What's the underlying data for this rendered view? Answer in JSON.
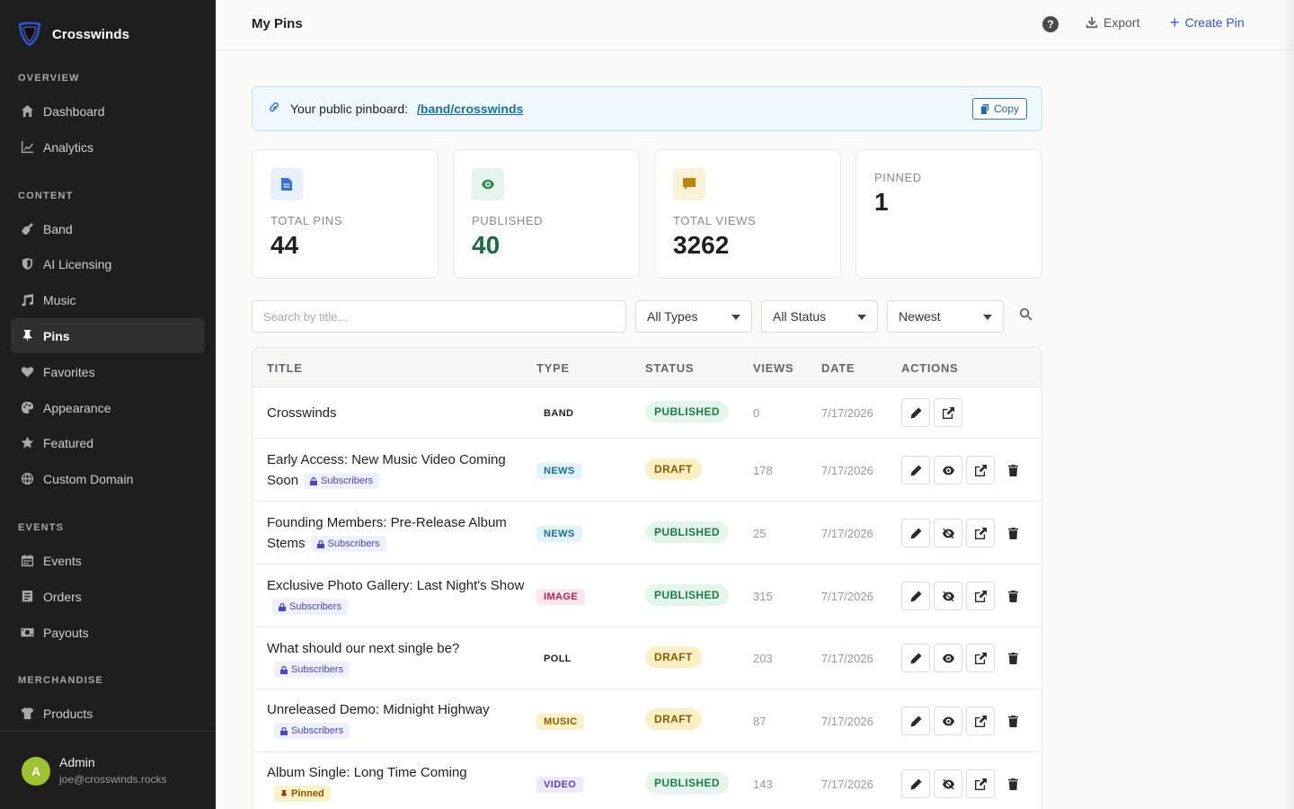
{
  "brand": {
    "name": "Crosswinds"
  },
  "sidebar": {
    "sections": {
      "overview": "OVERVIEW",
      "content": "CONTENT",
      "events": "EVENTS",
      "merch": "MERCHANDISE"
    },
    "items": {
      "dashboard": "Dashboard",
      "analytics": "Analytics",
      "band": "Band",
      "ai": "AI Licensing",
      "music": "Music",
      "pins": "Pins",
      "favorites": "Favorites",
      "appearance": "Appearance",
      "featured": "Featured",
      "domain": "Custom Domain",
      "events": "Events",
      "orders": "Orders",
      "payouts": "Payouts",
      "products": "Products"
    },
    "user": {
      "initial": "A",
      "name": "Admin",
      "email": "joe@crosswinds.rocks"
    }
  },
  "header": {
    "title": "My Pins",
    "help": "?",
    "export_label": "Export",
    "create_label": "Create Pin",
    "create_plus": "+"
  },
  "banner": {
    "label": "Your public pinboard:",
    "link": "/band/crosswinds",
    "copy_label": "Copy"
  },
  "stats": {
    "total_pins": {
      "label": "TOTAL PINS",
      "value": "44"
    },
    "published": {
      "label": "PUBLISHED",
      "value": "40"
    },
    "total_views": {
      "label": "TOTAL VIEWS",
      "value": "3262"
    },
    "pinned": {
      "label": "PINNED",
      "value": "1"
    }
  },
  "filters": {
    "search_placeholder": "Search by title...",
    "type": "All Types",
    "status": "All Status",
    "sort": "Newest"
  },
  "table": {
    "headers": {
      "title": "TITLE",
      "type": "TYPE",
      "status": "STATUS",
      "views": "VIEWS",
      "date": "DATE",
      "actions": "ACTIONS"
    },
    "badge_subscribers": "Subscribers",
    "badge_pinned": "Pinned",
    "rows": [
      {
        "title": "Crosswinds",
        "type": "BAND",
        "status": "PUBLISHED",
        "views": "0",
        "date": "7/17/2026"
      },
      {
        "title": "Early Access: New Music Video Coming Soon",
        "type": "NEWS",
        "status": "DRAFT",
        "views": "178",
        "date": "7/17/2026"
      },
      {
        "title": "Founding Members: Pre-Release Album Stems",
        "type": "NEWS",
        "status": "PUBLISHED",
        "views": "25",
        "date": "7/17/2026"
      },
      {
        "title": "Exclusive Photo Gallery: Last Night's Show",
        "type": "IMAGE",
        "status": "PUBLISHED",
        "views": "315",
        "date": "7/17/2026"
      },
      {
        "title": "What should our next single be?",
        "type": "POLL",
        "status": "DRAFT",
        "views": "203",
        "date": "7/17/2026"
      },
      {
        "title": "Unreleased Demo: Midnight Highway",
        "type": "MUSIC",
        "status": "DRAFT",
        "views": "87",
        "date": "7/17/2026"
      },
      {
        "title": "Album Single: Long Time Coming",
        "type": "VIDEO",
        "status": "PUBLISHED",
        "views": "143",
        "date": "7/17/2026"
      }
    ]
  },
  "colors": {
    "accent": "#2f54d9",
    "sidebar_bg": "#1e1e1e",
    "published": "#1e7a48",
    "draft": "#8a5a00"
  }
}
